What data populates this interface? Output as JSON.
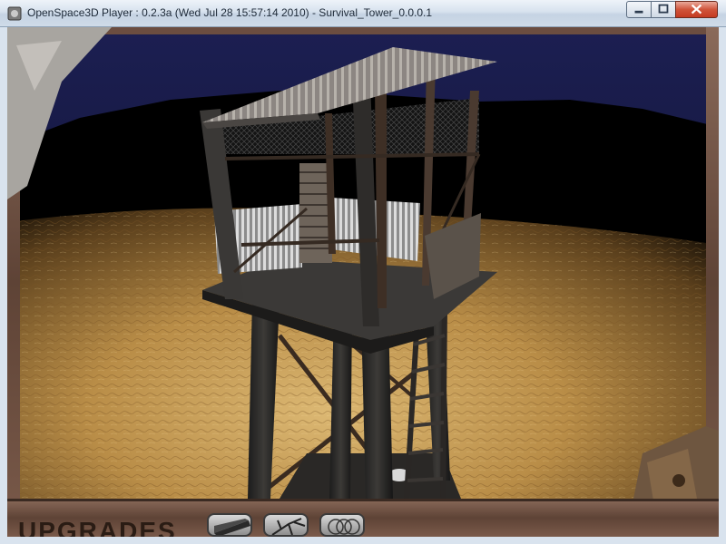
{
  "window": {
    "title": "OpenSpace3D Player : 0.2.3a (Wed Jul 28 15:57:14 2010) - Survival_Tower_0.0.0.1",
    "app_icon": "openspace3d-icon",
    "controls": [
      "minimize-icon",
      "maximize-icon",
      "close-icon"
    ]
  },
  "hud": {
    "upgrades_label": "UPGRADES",
    "slots": [
      {
        "name": "upgrade-slot-1",
        "icon": "metal-plate-icon"
      },
      {
        "name": "upgrade-slot-2",
        "icon": "branches-icon"
      },
      {
        "name": "upgrade-slot-3",
        "icon": "barbed-wire-icon"
      }
    ]
  },
  "colors": {
    "sky": "#14163a",
    "ground": "#b8904a",
    "frame_rust": "#6b4a3c"
  }
}
